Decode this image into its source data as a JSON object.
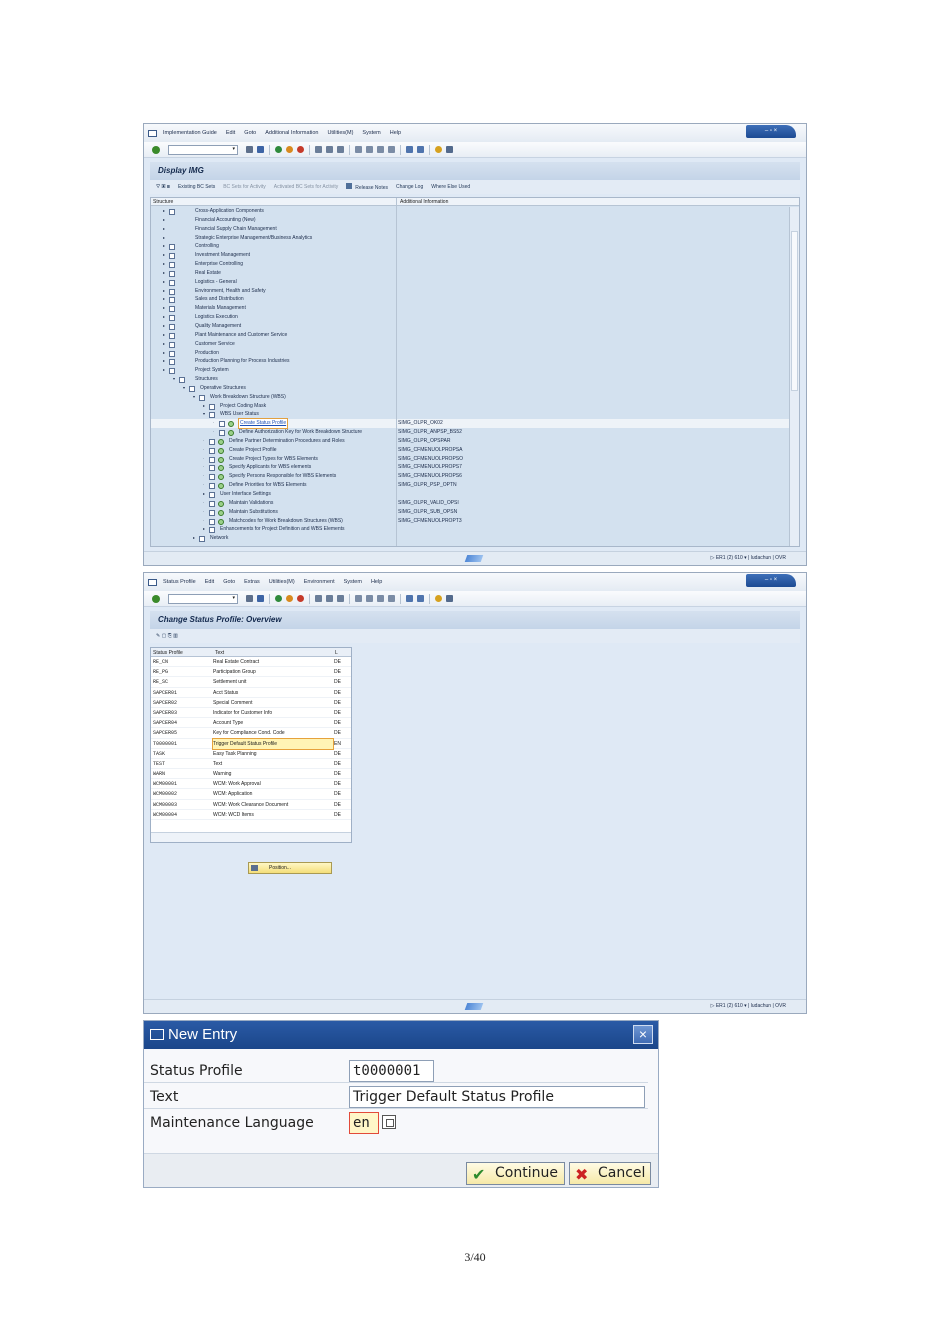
{
  "img": {
    "menu": [
      "Implementation Guide",
      "Edit",
      "Goto",
      "Additional Information",
      "Utilities(M)",
      "System",
      "Help"
    ],
    "title": "Display IMG",
    "app_toolbar": [
      "Existing BC Sets",
      "BC Sets for Activity",
      "Activated BC Sets for Activity",
      "Release Notes",
      "Change Log",
      "Where Else Used"
    ],
    "col_structure": "Structure",
    "col_info": "Additional Information",
    "tree": [
      {
        "level": 0,
        "label": "Cross-Application Components",
        "doc": true,
        "info": ""
      },
      {
        "level": 0,
        "label": "Financial Accounting (New)",
        "doc": false,
        "info": ""
      },
      {
        "level": 0,
        "label": "Financial Supply Chain Management",
        "doc": false,
        "info": ""
      },
      {
        "level": 0,
        "label": "Strategic Enterprise Management/Business Analytics",
        "doc": false,
        "info": ""
      },
      {
        "level": 0,
        "label": "Controlling",
        "doc": true,
        "info": ""
      },
      {
        "level": 0,
        "label": "Investment Management",
        "doc": true,
        "info": ""
      },
      {
        "level": 0,
        "label": "Enterprise Controlling",
        "doc": true,
        "info": ""
      },
      {
        "level": 0,
        "label": "Real Estate",
        "doc": true,
        "info": ""
      },
      {
        "level": 0,
        "label": "Logistics - General",
        "doc": true,
        "info": ""
      },
      {
        "level": 0,
        "label": "Environment, Health and Safety",
        "doc": true,
        "info": ""
      },
      {
        "level": 0,
        "label": "Sales and Distribution",
        "doc": true,
        "info": ""
      },
      {
        "level": 0,
        "label": "Materials Management",
        "doc": true,
        "info": ""
      },
      {
        "level": 0,
        "label": "Logistics Execution",
        "doc": true,
        "info": ""
      },
      {
        "level": 0,
        "label": "Quality Management",
        "doc": true,
        "info": ""
      },
      {
        "level": 0,
        "label": "Plant Maintenance and Customer Service",
        "doc": true,
        "info": ""
      },
      {
        "level": 0,
        "label": "Customer Service",
        "doc": true,
        "info": ""
      },
      {
        "level": 0,
        "label": "Production",
        "doc": true,
        "info": ""
      },
      {
        "level": 0,
        "label": "Production Planning for Process Industries",
        "doc": true,
        "info": ""
      },
      {
        "level": 0,
        "label": "Project System",
        "doc": true,
        "info": ""
      },
      {
        "level": 1,
        "label": "Structures",
        "doc": true,
        "info": ""
      },
      {
        "level": 2,
        "label": "Operative Structures",
        "doc": true,
        "info": ""
      },
      {
        "level": 3,
        "label": "Work Breakdown Structure (WBS)",
        "doc": true,
        "info": ""
      },
      {
        "level": 4,
        "label": "Project Coding Mask",
        "doc": true,
        "info": ""
      },
      {
        "level": 4,
        "label": "WBS User Status",
        "doc": true,
        "info": ""
      },
      {
        "level": 5,
        "label": "Create Status Profile",
        "doc": true,
        "act": true,
        "info": "SIMG_OLPR_OK02",
        "link": true
      },
      {
        "level": 5,
        "label": "Define Authorization Key for Work Breakdown Structure",
        "doc": true,
        "act": true,
        "info": "SIMG_OLPR_ANPSP_BS52"
      },
      {
        "level": 4,
        "label": "Define Partner Determination Procedures and Roles",
        "doc": true,
        "act": true,
        "info": "SIMG_OLPR_OPSPAR"
      },
      {
        "level": 4,
        "label": "Create Project Profile",
        "doc": true,
        "act": true,
        "info": "SIMG_CFMENUOLPROPSA"
      },
      {
        "level": 4,
        "label": "Create Project Types for WBS Elements",
        "doc": true,
        "act": true,
        "info": "SIMG_CFMENUOLPROPSO"
      },
      {
        "level": 4,
        "label": "Specify Applicants for WBS elements",
        "doc": true,
        "act": true,
        "info": "SIMG_CFMENUOLPROPS7"
      },
      {
        "level": 4,
        "label": "Specify Persons Responsible for WBS Elements",
        "doc": true,
        "act": true,
        "info": "SIMG_CFMENUOLPROPS6"
      },
      {
        "level": 4,
        "label": "Define Priorities for WBS Elements",
        "doc": true,
        "act": true,
        "info": "SIMG_OLPR_PSP_OPTN"
      },
      {
        "level": 4,
        "label": "User Interface Settings",
        "doc": true,
        "info": ""
      },
      {
        "level": 4,
        "label": "Maintain Validations",
        "doc": true,
        "act": true,
        "info": "SIMG_OLPR_VALID_OPSI"
      },
      {
        "level": 4,
        "label": "Maintain Substitutions",
        "doc": true,
        "act": true,
        "info": "SIMG_OLPR_SUB_OPSN"
      },
      {
        "level": 4,
        "label": "Matchcodes for Work Breakdown Structures (WBS)",
        "doc": true,
        "act": true,
        "info": "SIMG_CFMENUOLPROPT3"
      },
      {
        "level": 4,
        "label": "Enhancements for Project Definition and WBS Elements",
        "doc": true,
        "info": ""
      },
      {
        "level": 3,
        "label": "Network",
        "doc": true,
        "info": ""
      }
    ],
    "status_system": "ER1 (2) 610",
    "status_user": "ludachun",
    "status_mode": "OVR"
  },
  "sp": {
    "menu": [
      "Status Profile",
      "Edit",
      "Goto",
      "Extras",
      "Utilities(M)",
      "Environment",
      "System",
      "Help"
    ],
    "title": "Change Status Profile: Overview",
    "col_profile": "Status Profile",
    "col_text": "Text",
    "col_lang": "L",
    "rows": [
      {
        "profile": "RE_CN",
        "text": "Real Estate Contract",
        "lang": "DE"
      },
      {
        "profile": "RE_PG",
        "text": "Participation Group",
        "lang": "DE"
      },
      {
        "profile": "RE_SC",
        "text": "Settlement unit",
        "lang": "DE"
      },
      {
        "profile": "SAPCER01",
        "text": "Acct Status",
        "lang": "DE"
      },
      {
        "profile": "SAPCER02",
        "text": "Special Comment",
        "lang": "DE"
      },
      {
        "profile": "SAPCER03",
        "text": "Indicator for Customer Info",
        "lang": "DE"
      },
      {
        "profile": "SAPCER04",
        "text": "Account Type",
        "lang": "DE"
      },
      {
        "profile": "SAPCER05",
        "text": "Key for Compliance Cond. Code",
        "lang": "DE"
      },
      {
        "profile": "T0000001",
        "text": "Trigger Default Status Profile",
        "lang": "EN",
        "hl": true
      },
      {
        "profile": "TASK",
        "text": "Easy Task Planning",
        "lang": "DE"
      },
      {
        "profile": "TEST",
        "text": "Text",
        "lang": "DE"
      },
      {
        "profile": "WARN",
        "text": "Warning",
        "lang": "DE"
      },
      {
        "profile": "WCM00001",
        "text": "WCM: Work Approval",
        "lang": "DE"
      },
      {
        "profile": "WCM00002",
        "text": "WCM: Application",
        "lang": "DE"
      },
      {
        "profile": "WCM00003",
        "text": "WCM: Work Clearance Document",
        "lang": "DE"
      },
      {
        "profile": "WCM00004",
        "text": "WCM: WCD Items",
        "lang": "DE"
      }
    ],
    "position_button": "Position...",
    "status_system": "ER1 (2) 610",
    "status_user": "ludachun",
    "status_mode": "OVR"
  },
  "dialog": {
    "title": "New Entry",
    "status_profile_label": "Status Profile",
    "status_profile_value": "t0000001",
    "text_label": "Text",
    "text_value": "Trigger Default Status Profile",
    "language_label": "Maintenance Language",
    "language_value": "en",
    "continue": "Continue",
    "cancel": "Cancel"
  },
  "page_number": "3/40"
}
